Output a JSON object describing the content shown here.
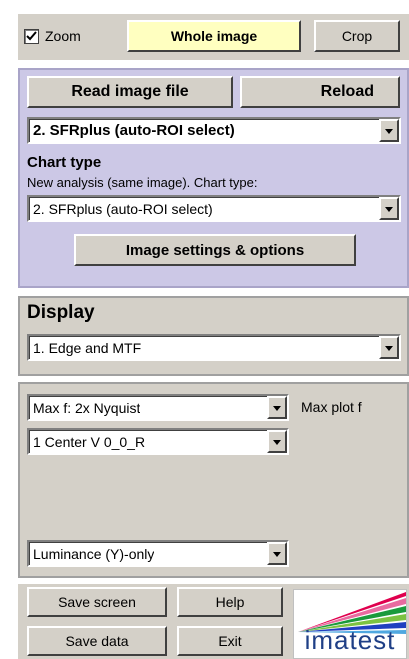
{
  "zoom": {
    "label": "Zoom",
    "checked": true
  },
  "view_buttons": {
    "whole_image": "Whole image",
    "crop": "Crop"
  },
  "file": {
    "read_image_file": "Read image file",
    "reload": "Reload"
  },
  "analysis_select": {
    "value": "2. SFRplus (auto-ROI select)"
  },
  "chart_type": {
    "heading": "Chart type",
    "description": "New analysis (same image). Chart type:",
    "value": "2. SFRplus (auto-ROI select)"
  },
  "image_settings_button": "Image settings & options",
  "display": {
    "heading": "Display",
    "value": "1.  Edge and MTF"
  },
  "plot": {
    "max_f_value": "Max f:   2x Nyquist",
    "max_plot_f_label": "Max plot f",
    "region_value": "1  Center  V     0_0_R",
    "channel_value": "Luminance (Y)-only"
  },
  "bottom": {
    "save_screen": "Save screen",
    "help": "Help",
    "save_data": "Save data",
    "exit": "Exit"
  },
  "logo": {
    "text": "imatest"
  },
  "colors": {
    "highlight_button": "#ffffc0",
    "lavender_panel": "#ccc8e6",
    "panel_grey": "#d4d0c8",
    "logo_text": "#1f3f86"
  }
}
